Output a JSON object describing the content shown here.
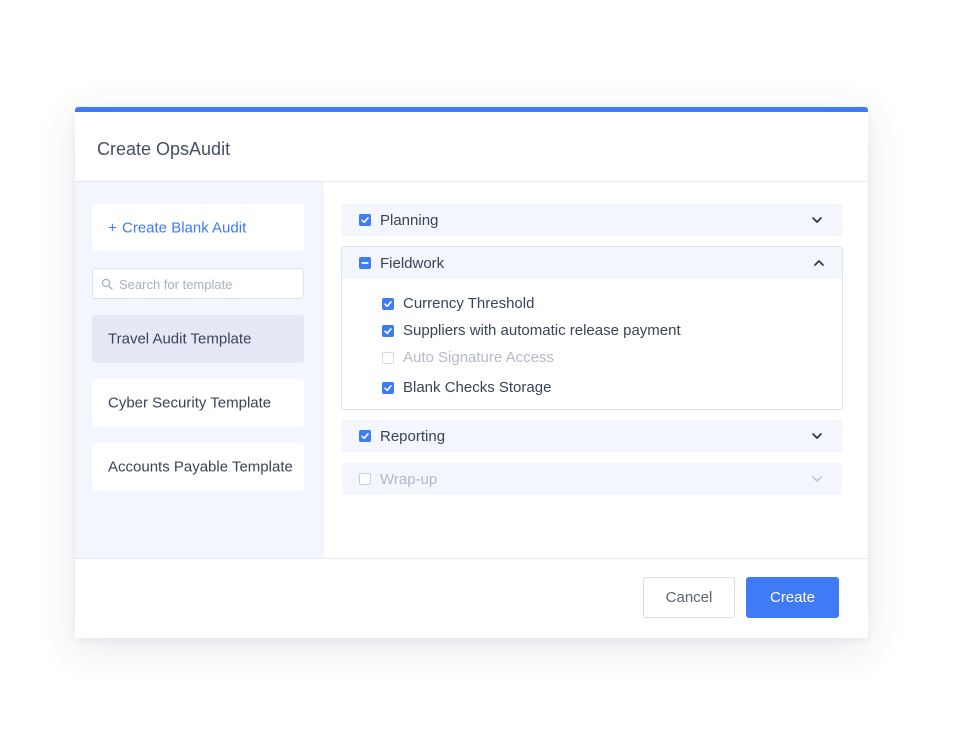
{
  "dialog": {
    "title": "Create OpsAudit"
  },
  "sidebar": {
    "create_blank_label": "Create Blank Audit",
    "create_blank_plus": "+",
    "search_placeholder": "Search for template",
    "templates": [
      {
        "label": "Travel Audit Template",
        "selected": true
      },
      {
        "label": "Cyber Security Template",
        "selected": false
      },
      {
        "label": "Accounts Payable Template",
        "selected": false
      }
    ]
  },
  "sections": {
    "planning": {
      "label": "Planning",
      "state": "checked",
      "expanded": false
    },
    "fieldwork": {
      "label": "Fieldwork",
      "state": "partial",
      "expanded": true,
      "items": [
        {
          "label": "Currency Threshold",
          "checked": true,
          "disabled": false
        },
        {
          "label": "Suppliers with automatic release payment",
          "checked": true,
          "disabled": false
        },
        {
          "label": "Auto Signature Access",
          "checked": false,
          "disabled": true
        },
        {
          "label": "Blank Checks Storage",
          "checked": true,
          "disabled": false
        }
      ]
    },
    "reporting": {
      "label": "Reporting",
      "state": "checked",
      "expanded": false
    },
    "wrapup": {
      "label": "Wrap-up",
      "state": "unchecked",
      "expanded": false,
      "disabled": true
    }
  },
  "footer": {
    "cancel_label": "Cancel",
    "create_label": "Create"
  },
  "colors": {
    "accent": "#3e7bf5",
    "sidebar_bg": "#f3f6fc",
    "selected_template_bg": "#e4e9f5"
  }
}
